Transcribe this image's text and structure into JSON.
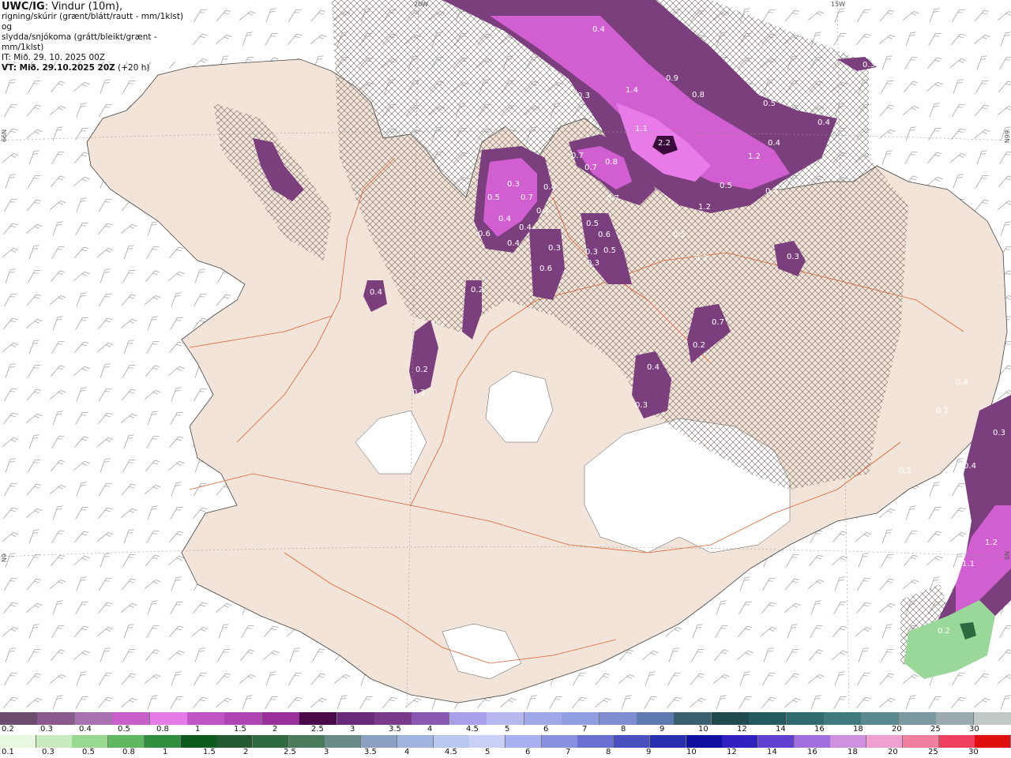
{
  "header": {
    "title_bold": "UWC/IG",
    "title_rest": ": Vindur (10m),",
    "line2": "rigning/skúrir (grænt/blátt/rautt - mm/1klst) og",
    "line3": "slydda/snjókoma (grátt/bleikt/grænt - mm/1klst)",
    "line4": "IT: Mið. 29. 10. 2025 00Z",
    "line5_bold": "VT: Mið. 29.10.2025 20Z",
    "line5_rest": " (+20 h)"
  },
  "grid_labels": {
    "top_left": "20W",
    "top_right": "15W",
    "left_upper": "66N",
    "right_upper": "66N",
    "left_lower": "N9",
    "right_lower": "N9"
  },
  "value_labels": [
    "0.4",
    "0.3",
    "1.4",
    "0.3",
    "0.9",
    "0.8",
    "0.3",
    "0.5",
    "0.4",
    "2.2",
    "1.1",
    "0.4",
    "1.2",
    "0.4",
    "0.3",
    "0.4",
    "0.5",
    "0.7",
    "0.4",
    "0.7",
    "0.8",
    "0.7",
    "0.7",
    "0.4",
    "0.4",
    "1.2",
    "0.5",
    "0.6",
    "0.4",
    "0.3",
    "0.5",
    "0.6",
    "0.3",
    "0.5",
    "0.6",
    "0.3",
    "0.3",
    "0.3",
    "0.5",
    "0.7",
    "0.2",
    "0.2",
    "0.4",
    "0.2",
    "0.3",
    "0.4",
    "0.2",
    "0.3",
    "0.4",
    "0.2",
    "0.3",
    "0.4",
    "0.2",
    "1.2",
    "1.1",
    "0.2"
  ],
  "legend": {
    "snow_colors": [
      "#6b4c6d",
      "#8a5a8e",
      "#a872b0",
      "#c85ec8",
      "#e67ae6",
      "#c254c7",
      "#b044b4",
      "#9a2f99",
      "#4a0a4a",
      "#6a2a7a",
      "#7a3a8a",
      "#8a58b0",
      "#a7a0e8",
      "#b8b8f0",
      "#a0a8e8",
      "#8f9ee0",
      "#7f8ed0",
      "#5f7ab0",
      "#3a5f6f",
      "#1f4a4f",
      "#245a5f",
      "#2f6a6f",
      "#3f7a7f",
      "#5a8a8f",
      "#7a9a9f",
      "#9aaaae",
      "#c0c8c8"
    ],
    "snow_ticks": [
      "0.2",
      "0.3",
      "0.4",
      "0.5",
      "0.8",
      "1",
      "1.5",
      "2",
      "2.5",
      "3",
      "3.5",
      "4",
      "4.5",
      "5",
      "6",
      "7",
      "8",
      "9",
      "10",
      "12",
      "14",
      "16",
      "18",
      "20",
      "25",
      "30"
    ],
    "rain_colors": [
      "#e8f8e0",
      "#c8ecc0",
      "#98d890",
      "#60b860",
      "#2f8f3f",
      "#0f5a1f",
      "#235a2f",
      "#2f6a3f",
      "#4a7a5a",
      "#6a8a8a",
      "#8aa0c0",
      "#a0b4e0",
      "#b8c8f0",
      "#c8d0f8",
      "#a8b0f0",
      "#8890e0",
      "#6870d0",
      "#4850c0",
      "#2830b0",
      "#1010a0",
      "#3020c0",
      "#6040d0",
      "#a070e0",
      "#d090e0",
      "#f0a0d0",
      "#f080a0",
      "#f04060",
      "#e01010"
    ],
    "rain_ticks": [
      "0.1",
      "0.3",
      "0.5",
      "0.8",
      "1",
      "1.5",
      "2",
      "2.5",
      "3",
      "3.5",
      "4",
      "4.5",
      "5",
      "6",
      "7",
      "8",
      "9",
      "10",
      "12",
      "14",
      "16",
      "18",
      "20",
      "25",
      "30"
    ]
  }
}
